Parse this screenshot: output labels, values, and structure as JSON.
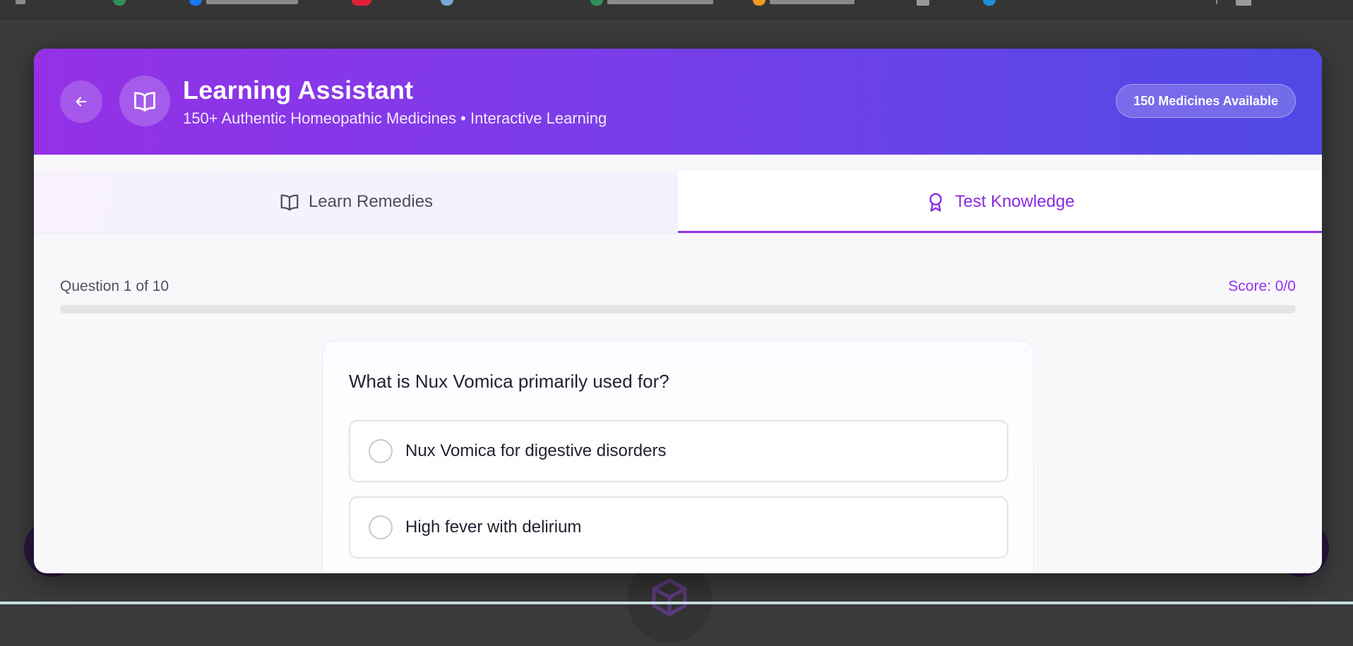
{
  "header": {
    "title": "Learning Assistant",
    "subtitle": "150+ Authentic Homeopathic Medicines • Interactive Learning",
    "badge": "150 Medicines Available",
    "back_icon": "arrow-left-icon",
    "logo_icon": "open-book-icon"
  },
  "tabs": [
    {
      "label": "Learn Remedies",
      "icon": "open-book-icon",
      "active": false
    },
    {
      "label": "Test Knowledge",
      "icon": "award-icon",
      "active": true
    }
  ],
  "quiz": {
    "progress_text": "Question 1 of 10",
    "score_text": "Score: 0/0",
    "progress_fraction": 0,
    "question": "What is Nux Vomica primarily used for?",
    "options": [
      {
        "text": "Nux Vomica for digestive disorders",
        "selected": false
      },
      {
        "text": "High fever with delirium",
        "selected": false
      }
    ]
  },
  "colors": {
    "accent": "#9333ea",
    "header_gradient_start": "#9431e6",
    "header_gradient_end": "#4f48e5",
    "text_primary": "#1f2230",
    "text_muted": "#4e5260"
  }
}
